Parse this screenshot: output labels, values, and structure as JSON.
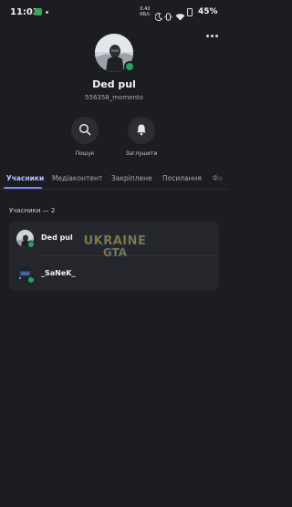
{
  "status_bar": {
    "time": "11:03",
    "net_speed": "0,42 КБ/с",
    "battery": "45%"
  },
  "profile": {
    "name": "Ded pul",
    "tag": "556358_momento",
    "status_color": "#23a55a"
  },
  "actions": [
    {
      "label": "Пошук",
      "icon": "search-icon"
    },
    {
      "label": "Заглушити",
      "icon": "bell-icon"
    }
  ],
  "tabs": [
    {
      "label": "Учасники",
      "active": true
    },
    {
      "label": "Медіаконтент",
      "active": false
    },
    {
      "label": "Закріплене",
      "active": false
    },
    {
      "label": "Посилання",
      "active": false
    },
    {
      "label": "Фа",
      "active": false
    }
  ],
  "members": {
    "title": "Учасники — 2",
    "items": [
      {
        "name": "Ded pul",
        "online": true
      },
      {
        "name": "_SaNeK_",
        "online": true
      }
    ]
  },
  "watermark": {
    "line1": "UKRAINE",
    "line2": "GTA"
  },
  "colors": {
    "accent": "#7289ff",
    "background": "#1c1d22",
    "card": "#25262c",
    "online": "#23a55a"
  }
}
